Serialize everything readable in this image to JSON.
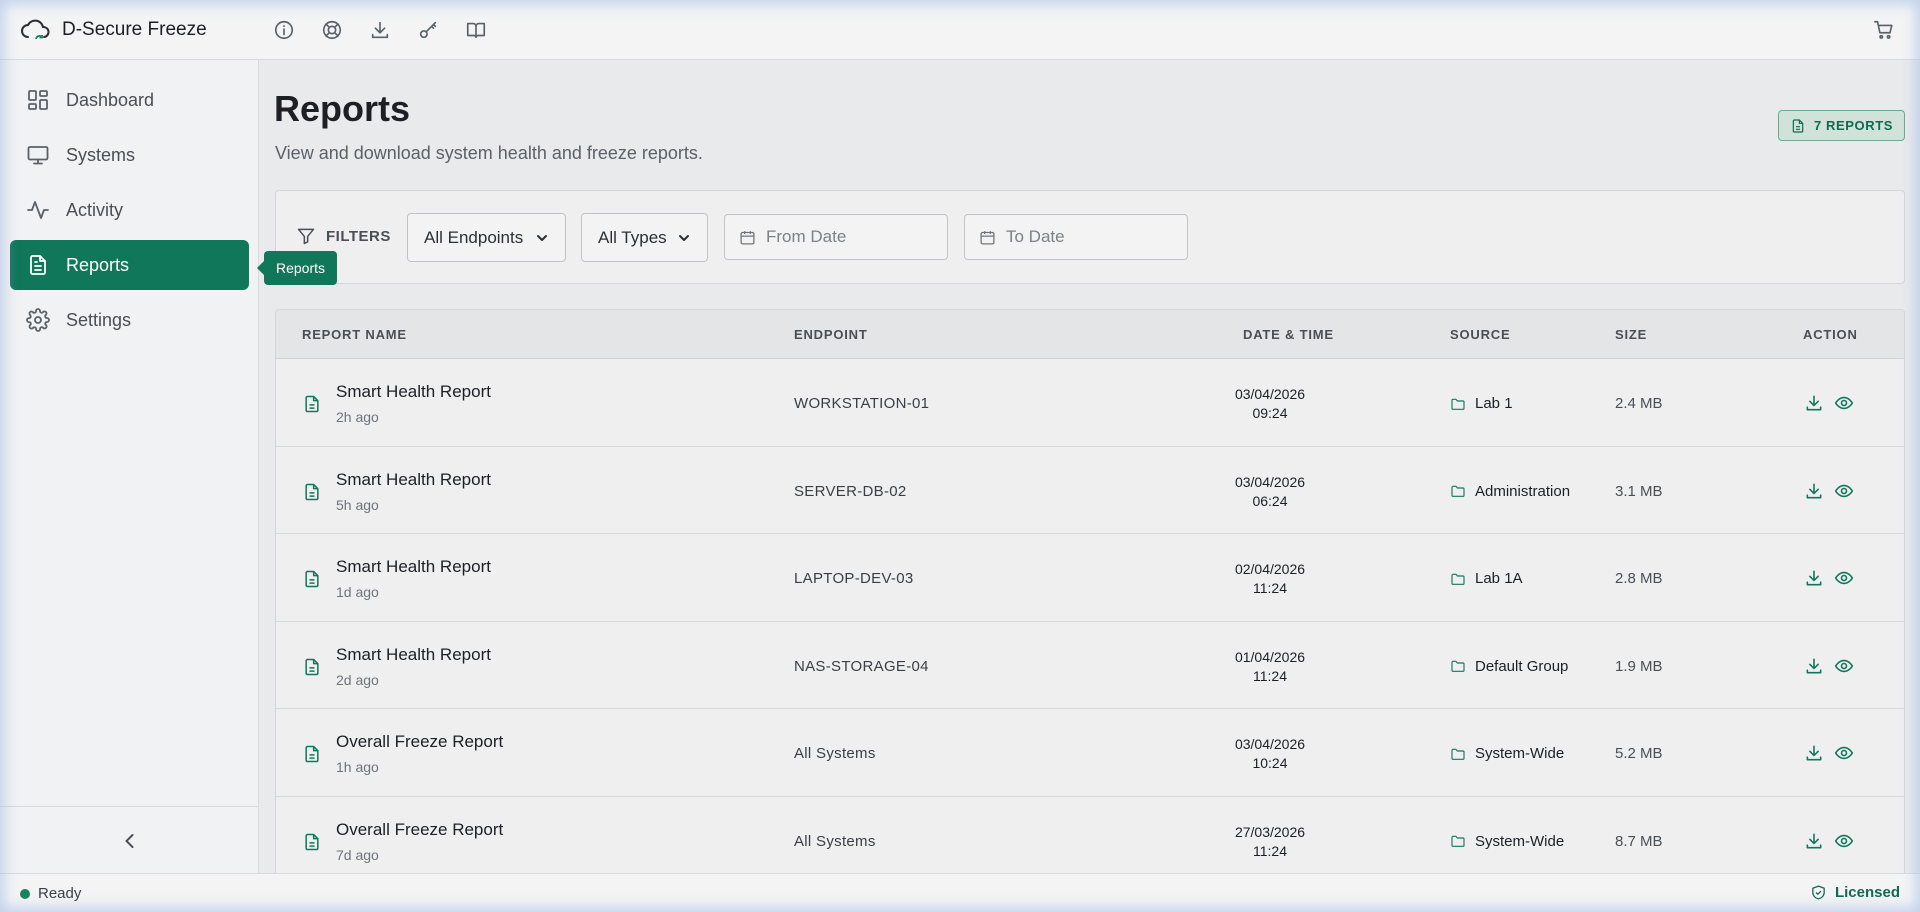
{
  "app": {
    "title": "D-Secure Freeze",
    "logo_icon": "cloud-sync-icon"
  },
  "toolbar": {
    "icons": [
      "info-icon",
      "lifebuoy-icon",
      "download-icon",
      "key-icon",
      "book-icon"
    ],
    "cart_icon": "cart-icon"
  },
  "sidebar": {
    "items": [
      {
        "label": "Dashboard",
        "icon": "dashboard-icon",
        "active": false
      },
      {
        "label": "Systems",
        "icon": "monitor-icon",
        "active": false
      },
      {
        "label": "Activity",
        "icon": "activity-icon",
        "active": false
      },
      {
        "label": "Reports",
        "icon": "report-icon",
        "active": true
      },
      {
        "label": "Settings",
        "icon": "gear-icon",
        "active": false
      }
    ],
    "tooltip": "Reports",
    "collapse_icon": "chevron-left-icon"
  },
  "page": {
    "title": "Reports",
    "subtitle": "View and download system health and freeze reports.",
    "count_badge": "7 REPORTS"
  },
  "filters": {
    "label": "FILTERS",
    "endpoint_select": "All Endpoints",
    "type_select": "All Types",
    "from_date_placeholder": "From Date",
    "to_date_placeholder": "To Date"
  },
  "table": {
    "headers": {
      "name": "REPORT NAME",
      "endpoint": "ENDPOINT",
      "datetime": "DATE & TIME",
      "source": "SOURCE",
      "size": "SIZE",
      "action": "ACTION"
    },
    "rows": [
      {
        "name": "Smart Health Report",
        "ago": "2h ago",
        "endpoint": "WORKSTATION-01",
        "date": "03/04/2026",
        "time": "09:24",
        "source": "Lab 1",
        "size": "2.4 MB"
      },
      {
        "name": "Smart Health Report",
        "ago": "5h ago",
        "endpoint": "SERVER-DB-02",
        "date": "03/04/2026",
        "time": "06:24",
        "source": "Administration",
        "size": "3.1 MB"
      },
      {
        "name": "Smart Health Report",
        "ago": "1d ago",
        "endpoint": "LAPTOP-DEV-03",
        "date": "02/04/2026",
        "time": "11:24",
        "source": "Lab 1A",
        "size": "2.8 MB"
      },
      {
        "name": "Smart Health Report",
        "ago": "2d ago",
        "endpoint": "NAS-STORAGE-04",
        "date": "01/04/2026",
        "time": "11:24",
        "source": "Default Group",
        "size": "1.9 MB"
      },
      {
        "name": "Overall Freeze Report",
        "ago": "1h ago",
        "endpoint": "All Systems",
        "date": "03/04/2026",
        "time": "10:24",
        "source": "System-Wide",
        "size": "5.2 MB"
      },
      {
        "name": "Overall Freeze Report",
        "ago": "7d ago",
        "endpoint": "All Systems",
        "date": "27/03/2026",
        "time": "11:24",
        "source": "System-Wide",
        "size": "8.7 MB"
      }
    ]
  },
  "status": {
    "text": "Ready",
    "license": "Licensed"
  },
  "colors": {
    "accent": "#11775b",
    "background": "#e9eaec"
  }
}
